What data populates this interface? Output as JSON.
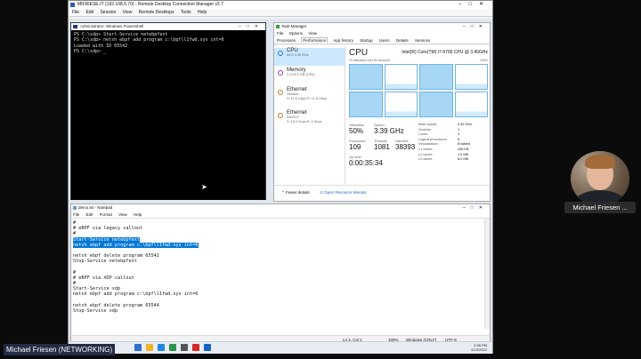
{
  "rdm": {
    "title": "MIFRIESE-IT (192.168.5.70) - Remote Desktop Connection Manager v2.7",
    "menu": [
      "File",
      "Edit",
      "Session",
      "View",
      "Remote Desktops",
      "Tools",
      "Help"
    ]
  },
  "powershell": {
    "title": "Administrator: Windows PowerShell",
    "lines": [
      "PS C:\\xdp> Start-Service netebpfext",
      "PS C:\\xdp> netsh ebpf add program c:\\bpf\\l1fwd.sys int=6",
      "Loaded with ID 65542",
      "",
      "PS C:\\xdp> _"
    ]
  },
  "taskmanager": {
    "title": "Task Manager",
    "menu": [
      "File",
      "Options",
      "View"
    ],
    "tabs": [
      "Processes",
      "Performance",
      "App history",
      "Startup",
      "Users",
      "Details",
      "Services"
    ],
    "resources": [
      {
        "name": "CPU",
        "sub": "50% 3.39 GHz"
      },
      {
        "name": "Memory",
        "sub": "2.1/15.9 GB (13%)"
      },
      {
        "name": "Ethernet",
        "sub": "vSwitch\nS: 11.6 Gbps R: 11.6 Gbps"
      },
      {
        "name": "Ethernet",
        "sub": "NDISVT\nS: 16.0 Kbps R: 0 Kbps"
      }
    ],
    "cpu_heading": "CPU",
    "cpu_model": "Intel(R) Core(TM) i7-6700 CPU @ 3.40GHz",
    "util_label": "% Utilization over 60 seconds",
    "util_max": "100%",
    "core_loads": [
      1.0,
      0.0,
      1.0,
      0.0,
      1.0,
      0.0,
      1.0,
      0.0
    ],
    "stats": {
      "utilization_label": "Utilization",
      "utilization": "50%",
      "speed_label": "Speed",
      "speed": "3.39 GHz",
      "processes_label": "Processes",
      "processes": "109",
      "threads_label": "Threads",
      "threads": "1081",
      "handles_label": "Handles",
      "handles": "38393",
      "uptime_label": "Up time",
      "uptime": "0:00:35:34"
    },
    "specs": [
      {
        "k": "Base speed:",
        "v": "3.40 GHz"
      },
      {
        "k": "Sockets:",
        "v": "1"
      },
      {
        "k": "Cores:",
        "v": "4"
      },
      {
        "k": "Logical processors:",
        "v": "8"
      },
      {
        "k": "Virtualization:",
        "v": "Enabled"
      },
      {
        "k": "L1 cache:",
        "v": "256 KB"
      },
      {
        "k": "L2 cache:",
        "v": "1.0 MB"
      },
      {
        "k": "L3 cache:",
        "v": "8.0 MB"
      }
    ],
    "fewer_details": "Fewer details",
    "open_monitor": "Open Resource Monitor"
  },
  "notepad": {
    "title": "demo.txt - Notepad",
    "menu": [
      "File",
      "Edit",
      "Format",
      "View",
      "Help"
    ],
    "lines": [
      {
        "t": "#",
        "hl": false
      },
      {
        "t": "# eBPF via legacy callout",
        "hl": false
      },
      {
        "t": "#",
        "hl": false
      },
      {
        "t": "Start-Service netebpfext",
        "hl": true
      },
      {
        "t": "netsh ebpf add program c:\\bpf\\l1fwd.sys int=6",
        "hl": true
      },
      {
        "t": "",
        "hl": false
      },
      {
        "t": "netsh ebpf delete program 65542",
        "hl": false
      },
      {
        "t": "Stop-Service netebpfext",
        "hl": false
      },
      {
        "t": "",
        "hl": false
      },
      {
        "t": "#",
        "hl": false
      },
      {
        "t": "# eBPF via XDP callout",
        "hl": false
      },
      {
        "t": "#",
        "hl": false
      },
      {
        "t": "Start-Service xdp",
        "hl": false
      },
      {
        "t": "netsh ebpf add program c:\\bpf\\l1fwd.sys int=6",
        "hl": false
      },
      {
        "t": "",
        "hl": false
      },
      {
        "t": "netsh ebpf delete program 65544",
        "hl": false
      },
      {
        "t": "Stop-Service xdp",
        "hl": false
      }
    ],
    "status": {
      "pos": "Ln 4, Col 1",
      "zoom": "100%",
      "eol": "Windows (CRLF)",
      "enc": "UTF-8"
    }
  },
  "taskbar": {
    "time": "2:38 PM",
    "date": "2/23/2022",
    "icon_colors": [
      "#2f6fd1",
      "#f0b429",
      "#1e88e5",
      "#2b9348",
      "#555555",
      "#d62828",
      "#1565c0"
    ]
  },
  "webcam": {
    "name": "Michael Friesen ..."
  },
  "speaker": {
    "name": "Michael Friesen (NETWORKING)"
  }
}
